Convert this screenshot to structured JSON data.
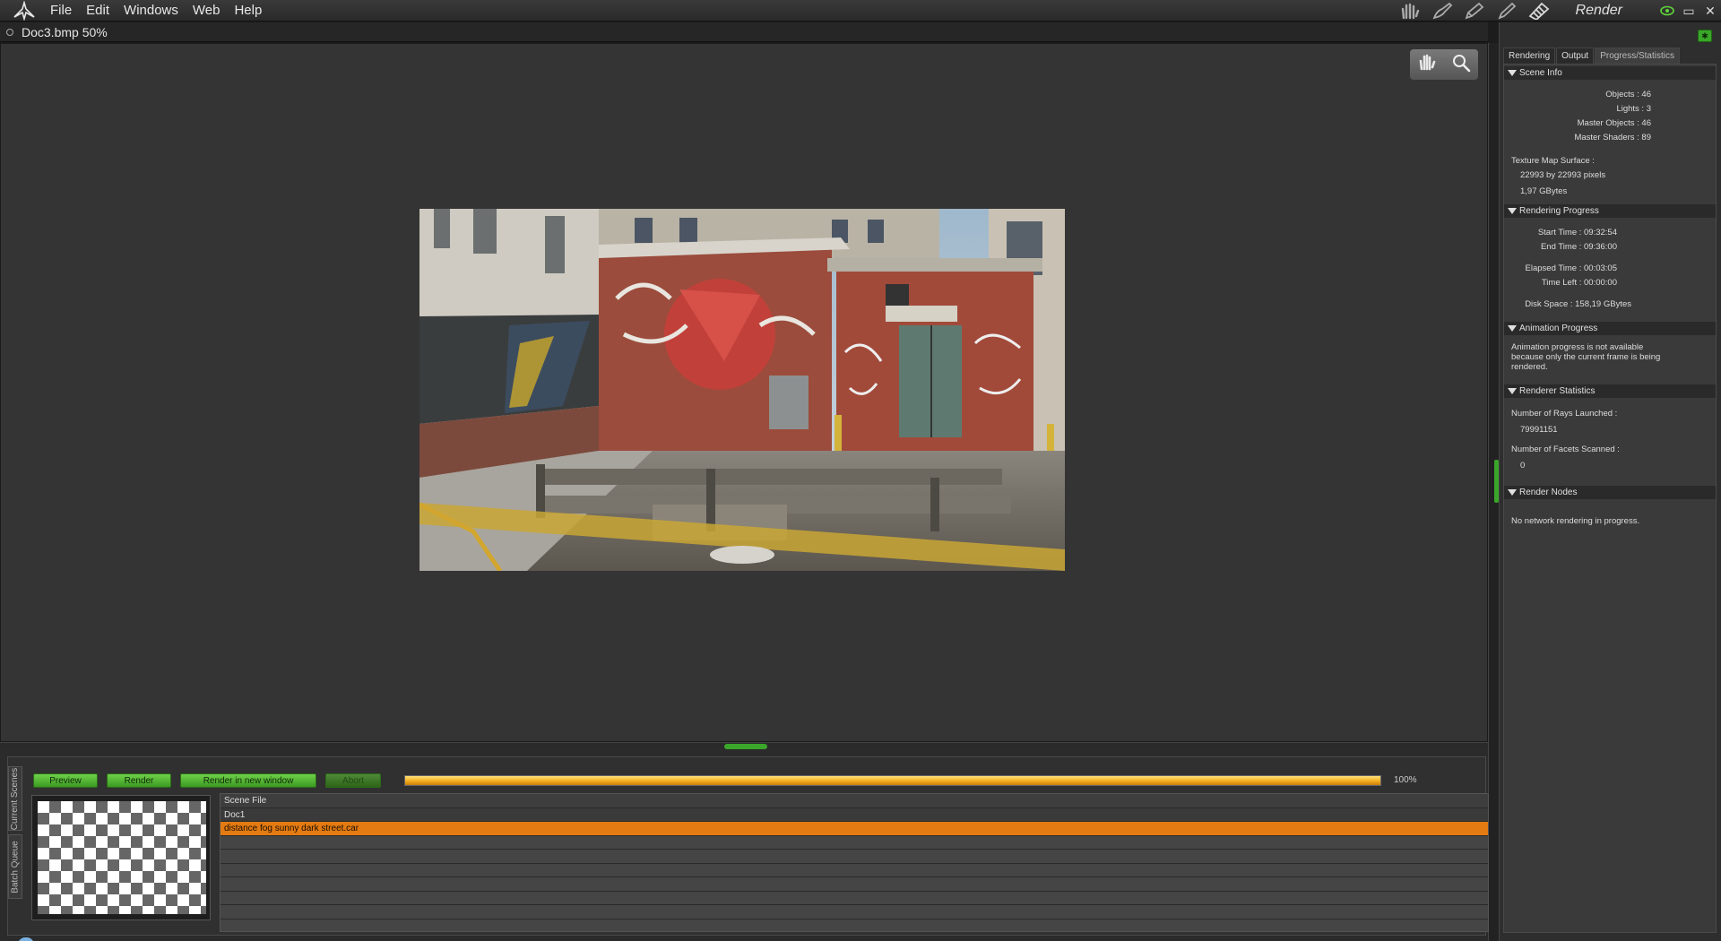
{
  "menubar": {
    "menu": [
      "File",
      "Edit",
      "Windows",
      "Web",
      "Help"
    ],
    "room_label": "Render",
    "win_minimize": "▭",
    "win_close": "✕"
  },
  "document": {
    "title": "Doc3.bmp 50%"
  },
  "render_controls": {
    "preview": "Preview",
    "render": "Render",
    "render_new_window": "Render in new window",
    "abort": "Abort",
    "progress": 1.0,
    "progress_label": "100%",
    "side_tab_current": "Current Scenes",
    "side_tab_batch": "Batch Queue"
  },
  "scene_table": {
    "header": "Scene File",
    "rows": [
      "Doc1",
      "distance fog sunny dark street.car"
    ]
  },
  "right_panel": {
    "tabs": [
      "Rendering",
      "Output",
      "Progress/Statistics"
    ],
    "scene_info": {
      "title": "Scene Info",
      "objects": "Objects : 46",
      "lights": "Lights : 3",
      "master_objects": "Master Objects : 46",
      "master_shaders": "Master Shaders : 89",
      "texture_label": "Texture Map Surface :",
      "texture_pixels": "22993 by 22993 pixels",
      "texture_size": "1,97 GBytes"
    },
    "rendering_progress": {
      "title": "Rendering Progress",
      "start": "Start Time : 09:32:54",
      "end": "End Time : 09:36:00",
      "elapsed": "Elapsed Time : 00:03:05",
      "left": "Time Left : 00:00:00",
      "disk": "Disk Space : 158,19 GBytes"
    },
    "animation_progress": {
      "title": "Animation Progress",
      "text": "Animation progress is not available because only the current frame is being rendered."
    },
    "renderer_statistics": {
      "title": "Renderer Statistics",
      "rays_label": "Number of Rays Launched :",
      "rays_value": "79991151",
      "facets_label": "Number of Facets Scanned :",
      "facets_value": "0"
    },
    "render_nodes": {
      "title": "Render Nodes",
      "text": "No network rendering in progress."
    }
  },
  "colors": {
    "accent_green": "#3aa62a",
    "selection_orange": "#e37b12"
  }
}
